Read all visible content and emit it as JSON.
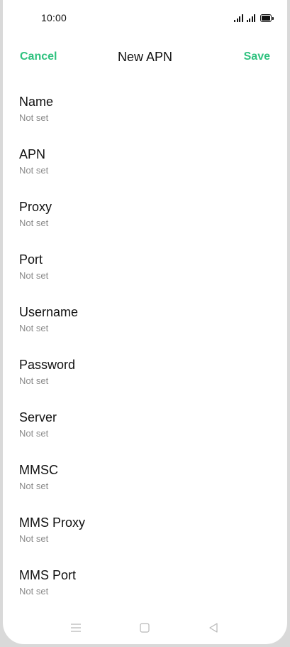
{
  "status_bar": {
    "time": "10:00",
    "icons": [
      "signal-icon",
      "signal-icon",
      "battery-icon"
    ]
  },
  "header": {
    "cancel_label": "Cancel",
    "title": "New APN",
    "save_label": "Save"
  },
  "fields": [
    {
      "label": "Name",
      "value": "Not set"
    },
    {
      "label": "APN",
      "value": "Not set"
    },
    {
      "label": "Proxy",
      "value": "Not set"
    },
    {
      "label": "Port",
      "value": "Not set"
    },
    {
      "label": "Username",
      "value": "Not set"
    },
    {
      "label": "Password",
      "value": "Not set"
    },
    {
      "label": "Server",
      "value": "Not set"
    },
    {
      "label": "MMSC",
      "value": "Not set"
    },
    {
      "label": "MMS Proxy",
      "value": "Not set"
    },
    {
      "label": "MMS Port",
      "value": "Not set"
    }
  ],
  "nav_bar": {
    "icons": [
      "menu-icon",
      "home-icon",
      "back-icon"
    ]
  },
  "colors": {
    "accent": "#2fc27f",
    "text_primary": "#111111",
    "text_secondary": "#8a8a8a",
    "background": "#ffffff"
  }
}
